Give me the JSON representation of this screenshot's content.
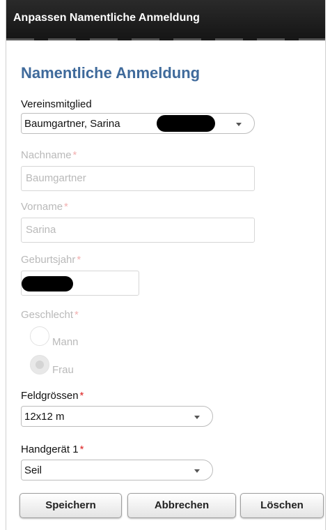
{
  "window": {
    "title": "Anpassen Namentliche Anmeldung"
  },
  "form": {
    "heading": "Namentliche Anmeldung",
    "member": {
      "label": "Vereinsmitglied",
      "value": "Baumgartner, Sarina"
    },
    "lastname": {
      "label": "Nachname",
      "required_mark": "*",
      "value": "Baumgartner"
    },
    "firstname": {
      "label": "Vorname",
      "required_mark": "*",
      "value": "Sarina"
    },
    "birthyear": {
      "label": "Geburtsjahr",
      "required_mark": "*"
    },
    "gender": {
      "label": "Geschlecht",
      "required_mark": "*",
      "options": [
        {
          "label": "Mann",
          "checked": false
        },
        {
          "label": "Frau",
          "checked": true
        }
      ]
    },
    "fieldsize": {
      "label": "Feldgrössen",
      "required_mark": "*",
      "value": "12x12 m"
    },
    "apparatus": {
      "label": "Handgerät 1",
      "required_mark": "*",
      "value": "Seil"
    }
  },
  "buttons": {
    "save": "Speichern",
    "cancel": "Abbrechen",
    "delete": "Löschen"
  },
  "colors": {
    "heading": "#3f6a9b",
    "required": "#dd2222",
    "titlebar": "#1e1e1e"
  }
}
